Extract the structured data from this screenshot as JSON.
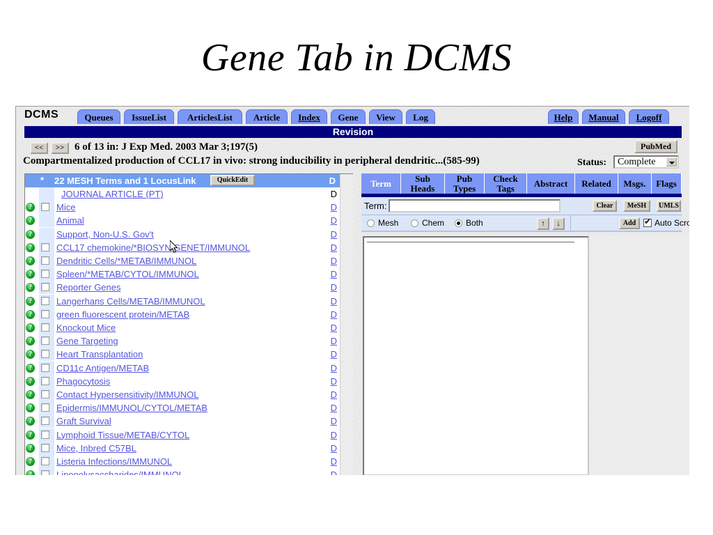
{
  "slide": {
    "title": "Gene Tab in DCMS"
  },
  "app": {
    "brand": "DCMS",
    "tabs": [
      {
        "label": "Queues",
        "active": false
      },
      {
        "label": "IssueList",
        "active": false
      },
      {
        "label": "ArticlesList",
        "active": false
      },
      {
        "label": "Article",
        "active": false
      },
      {
        "label": "Index",
        "active": true
      },
      {
        "label": "Gene",
        "active": false
      },
      {
        "label": "View",
        "active": false
      },
      {
        "label": "Log",
        "active": false
      }
    ],
    "right_tabs": [
      {
        "label": "Help"
      },
      {
        "label": "Manual"
      },
      {
        "label": "Logoff"
      }
    ],
    "revision_bar": "Revision",
    "nav": {
      "prev": "<<",
      "next": ">>"
    },
    "citation": "6 of 13 in:  J Exp Med. 2003 Mar 3;197(5)",
    "article_title": "Compartmentalized production of CCL17 in vivo: strong inducibility in peripheral dendritic...(585-99)",
    "pubmed_button": "PubMed",
    "status": {
      "label": "Status:",
      "value": "Complete"
    }
  },
  "list": {
    "header": {
      "star": "*",
      "text": "22 MESH Terms  and 1 LocusLink",
      "quickedit": "QuickEdit",
      "d": "D"
    },
    "d_label": "D",
    "help_icon_glyph": "?",
    "rows": [
      {
        "label": "JOURNAL ARTICLE (PT)",
        "icon": false,
        "checkbox": false,
        "d_link": false
      },
      {
        "label": "Mice",
        "icon": true,
        "checkbox": true,
        "d_link": true
      },
      {
        "label": "Animal",
        "icon": true,
        "checkbox": false,
        "d_link": true
      },
      {
        "label": "Support, Non-U.S. Gov't",
        "icon": true,
        "checkbox": false,
        "d_link": true
      },
      {
        "label": "CCL17 chemokine/*BIOSYN/GENET/IMMUNOL",
        "icon": true,
        "checkbox": true,
        "d_link": true
      },
      {
        "label": "Dendritic Cells/*METAB/IMMUNOL",
        "icon": true,
        "checkbox": true,
        "d_link": true
      },
      {
        "label": "Spleen/*METAB/CYTOL/IMMUNOL",
        "icon": true,
        "checkbox": true,
        "d_link": true
      },
      {
        "label": "Reporter Genes",
        "icon": true,
        "checkbox": true,
        "d_link": true
      },
      {
        "label": "Langerhans Cells/METAB/IMMUNOL",
        "icon": true,
        "checkbox": true,
        "d_link": true
      },
      {
        "label": "green fluorescent protein/METAB",
        "icon": true,
        "checkbox": true,
        "d_link": true
      },
      {
        "label": "Knockout Mice",
        "icon": true,
        "checkbox": true,
        "d_link": true
      },
      {
        "label": "Gene Targeting",
        "icon": true,
        "checkbox": true,
        "d_link": true
      },
      {
        "label": "Heart Transplantation",
        "icon": true,
        "checkbox": true,
        "d_link": true
      },
      {
        "label": "CD11c Antigen/METAB",
        "icon": true,
        "checkbox": true,
        "d_link": true
      },
      {
        "label": "Phagocytosis",
        "icon": true,
        "checkbox": true,
        "d_link": true
      },
      {
        "label": "Contact Hypersensitivity/IMMUNOL",
        "icon": true,
        "checkbox": true,
        "d_link": true
      },
      {
        "label": "Epidermis/IMMUNOL/CYTOL/METAB",
        "icon": true,
        "checkbox": true,
        "d_link": true
      },
      {
        "label": "Graft Survival",
        "icon": true,
        "checkbox": true,
        "d_link": true
      },
      {
        "label": "Lymphoid Tissue/METAB/CYTOL",
        "icon": true,
        "checkbox": true,
        "d_link": true
      },
      {
        "label": "Mice, Inbred C57BL",
        "icon": true,
        "checkbox": true,
        "d_link": true
      },
      {
        "label": "Listeria Infections/IMMUNOL",
        "icon": true,
        "checkbox": true,
        "d_link": true
      },
      {
        "label": "Lipopolysaccharides/IMMUNOL",
        "icon": true,
        "checkbox": true,
        "d_link": true
      }
    ]
  },
  "detail": {
    "tabs": [
      {
        "line1": "Term",
        "line2": "",
        "selected": true
      },
      {
        "line1": "Sub",
        "line2": "Heads",
        "selected": false
      },
      {
        "line1": "Pub",
        "line2": "Types",
        "selected": false
      },
      {
        "line1": "Check",
        "line2": "Tags",
        "selected": false
      },
      {
        "line1": "Abstract",
        "line2": "",
        "selected": false
      },
      {
        "line1": "Related",
        "line2": "",
        "selected": false
      },
      {
        "line1": "Msgs.",
        "line2": "",
        "selected": false
      },
      {
        "line1": "Flags",
        "line2": "",
        "selected": false
      }
    ],
    "term_label": "Term:",
    "term_value": "",
    "term_placeholder": "",
    "buttons": {
      "clear": "Clear",
      "mesh": "MeSH",
      "umls": "UMLS",
      "add": "Add"
    },
    "radios": [
      {
        "label": "Mesh",
        "selected": false
      },
      {
        "label": "Chem",
        "selected": false
      },
      {
        "label": "Both",
        "selected": true
      }
    ],
    "arrow_up": "↑",
    "arrow_down": "↓",
    "auto_scroll": {
      "label": "Auto Scroll",
      "checked": true
    }
  },
  "colors": {
    "tab_blue": "#7b96f5",
    "navy": "#000080",
    "header_blue": "#6f9ef0",
    "link_blue": "#5555dd",
    "panel_blue": "#dce6f7"
  }
}
